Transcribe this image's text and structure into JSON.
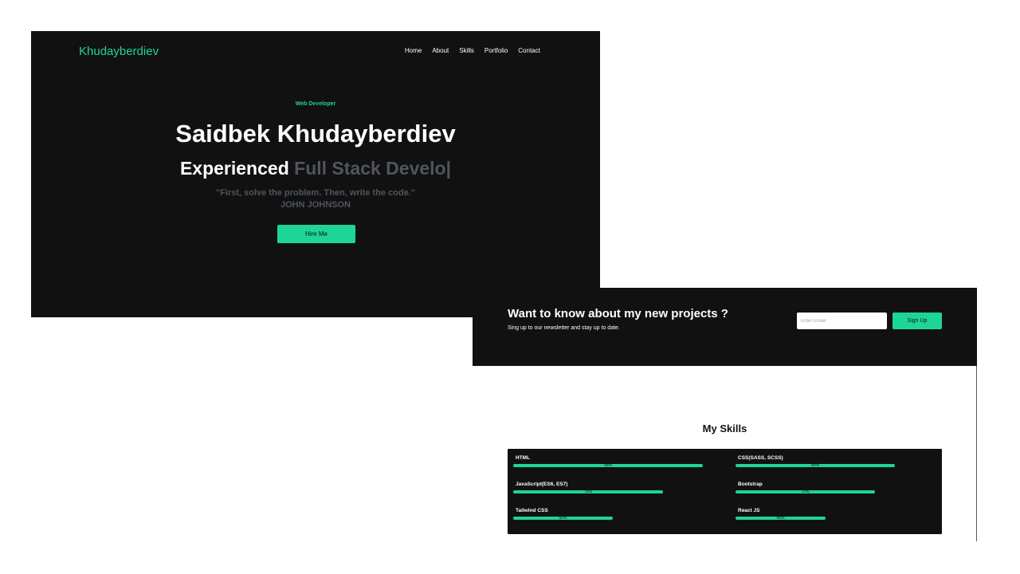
{
  "header": {
    "logo": "Khudayberdiev",
    "nav": [
      "Home",
      "About",
      "Skills",
      "Portfolio",
      "Contact"
    ]
  },
  "hero": {
    "eyebrow": "Web Developer",
    "name": "Saidbek Khudayberdiev",
    "role_prefix": "Experienced",
    "role_typed": "Full Stack Develo|",
    "quote": "\"First, solve the problem. Then, write the code.\"",
    "author": "JOHN JOHNSON",
    "cta": "Hire Me"
  },
  "newsletter": {
    "title": "Want to know about my new projects ?",
    "subtitle": "Sing up to our newsletter and stay up to date.",
    "email_placeholder": "Enter Email",
    "button": "Sign Up"
  },
  "skills": {
    "title": "My Skills",
    "items": [
      {
        "label": "HTML",
        "percent": 95,
        "percent_text": "95%"
      },
      {
        "label": "CSS(SASS, SCSS)",
        "percent": 80,
        "percent_text": "80%"
      },
      {
        "label": "JavaScript(ES6, ES7)",
        "percent": 75,
        "percent_text": "75%"
      },
      {
        "label": "Bootstrap",
        "percent": 70,
        "percent_text": "70%"
      },
      {
        "label": "Tailwind CSS",
        "percent": 50,
        "percent_text": "50%"
      },
      {
        "label": "React JS",
        "percent": 45,
        "percent_text": "45%"
      }
    ]
  },
  "colors": {
    "accent": "#1ed598",
    "dark": "#111111",
    "muted": "#50555f"
  }
}
